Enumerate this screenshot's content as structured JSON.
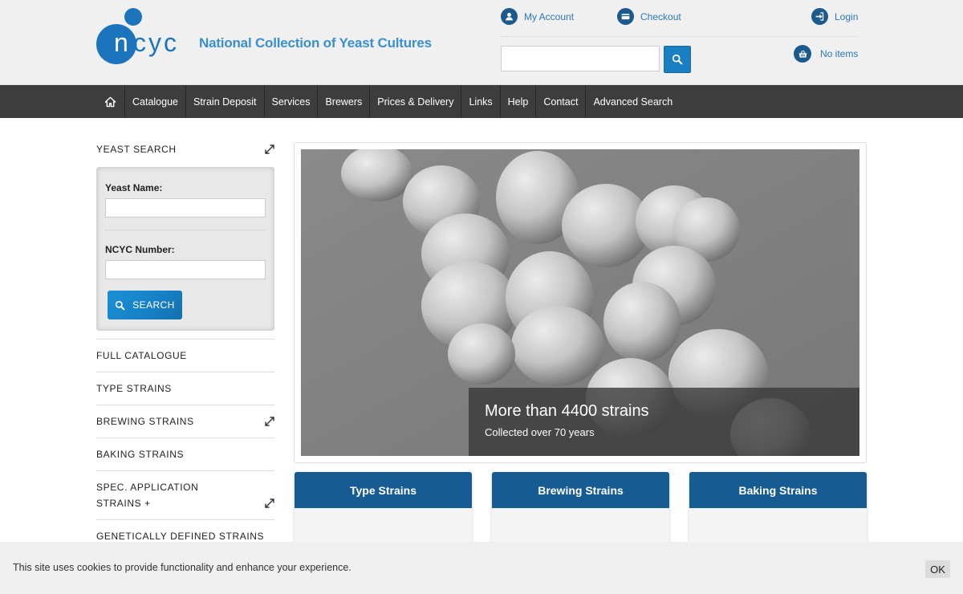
{
  "header": {
    "logo_text": "ncyc",
    "site_title": "National Collection of Yeast Cultures",
    "my_account": "My Account",
    "checkout": "Checkout",
    "login": "Login",
    "cart": "No items",
    "search_placeholder": ""
  },
  "nav": {
    "items": [
      "Catalogue",
      "Strain Deposit",
      "Services",
      "Brewers",
      "Prices & Delivery",
      "Links",
      "Help",
      "Contact",
      "Advanced Search"
    ]
  },
  "sidebar": {
    "yeast_search": "YEAST SEARCH",
    "yeast_name_label": "Yeast Name:",
    "yeast_name_value": "",
    "ncyc_number_label": "NCYC Number:",
    "ncyc_number_value": "",
    "search_button": "SEARCH",
    "links": [
      "FULL CATALOGUE",
      "TYPE STRAINS",
      "BREWING STRAINS",
      "BAKING STRAINS",
      "SPEC. APPLICATION STRAINS +",
      "GENETICALLY DEFINED STRAINS"
    ]
  },
  "hero": {
    "title": "More than 4400 strains",
    "subtitle": "Collected over 70 years"
  },
  "cards": [
    "Type Strains",
    "Brewing Strains",
    "Baking Strains"
  ],
  "cookie": {
    "text": "This site uses cookies to provide functionality and enhance your experience.",
    "ok": "OK"
  },
  "colors": {
    "brand_blue": "#1c75bc",
    "nav_dark": "#3d3d3d",
    "card_blue": "#165b91",
    "button_blue": "#1a7ec3"
  }
}
